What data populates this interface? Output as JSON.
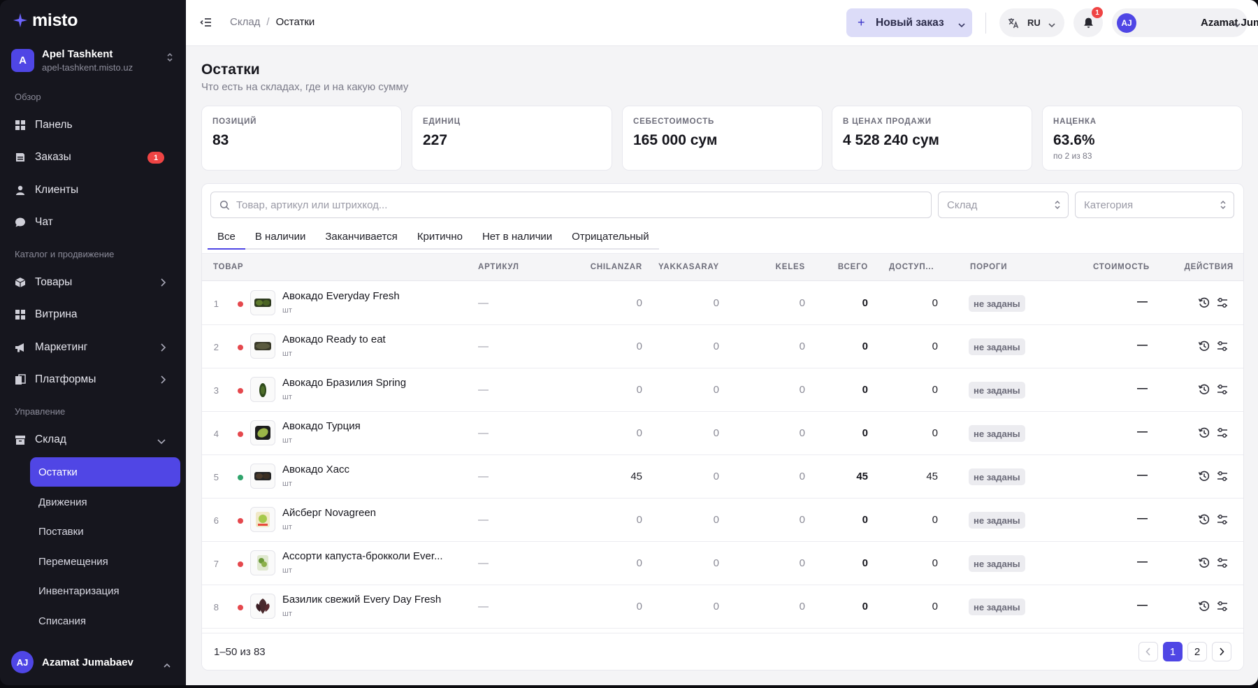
{
  "app": {
    "logo_text": "misto",
    "org_initial": "A",
    "org_name": "Apel Tashkent",
    "org_domain": "apel-tashkent.misto.uz"
  },
  "sidebar": {
    "sections": [
      "Обзор",
      "Каталог и продвижение",
      "Управление"
    ],
    "items": [
      {
        "label": "Панель",
        "icon": "dashboard-icon"
      },
      {
        "label": "Заказы",
        "icon": "orders-icon",
        "badge": "1"
      },
      {
        "label": "Клиенты",
        "icon": "users-icon"
      },
      {
        "label": "Чат",
        "icon": "chat-icon"
      },
      {
        "label": "Товары",
        "icon": "box-icon"
      },
      {
        "label": "Витрина",
        "icon": "storefront-icon"
      },
      {
        "label": "Маркетинг",
        "icon": "megaphone-icon"
      },
      {
        "label": "Платформы",
        "icon": "platforms-icon"
      },
      {
        "label": "Склад",
        "icon": "warehouse-icon"
      }
    ],
    "warehouse_sub": [
      "Остатки",
      "Движения",
      "Поставки",
      "Перемещения",
      "Инвентаризация",
      "Списания"
    ],
    "active_sub": "Остатки",
    "user_initials": "AJ",
    "user_name": "Azamat Jumabaev"
  },
  "topbar": {
    "breadcrumb_parent": "Склад",
    "breadcrumb_sep": "/",
    "breadcrumb_current": "Остатки",
    "new_order_label": "Новый заказ",
    "lang": "RU",
    "notifications": "1",
    "user_initials": "AJ",
    "user_name": "Azamat Jumabaev"
  },
  "page": {
    "title": "Остатки",
    "subtitle": "Что есть на складах, где и на какую сумму"
  },
  "stats": [
    {
      "label": "ПОЗИЦИЙ",
      "value": "83",
      "note": ""
    },
    {
      "label": "ЕДИНИЦ",
      "value": "227",
      "note": ""
    },
    {
      "label": "СЕБЕСТОИМОСТЬ",
      "value": "165 000 сум",
      "note": ""
    },
    {
      "label": "В ЦЕНАХ ПРОДАЖИ",
      "value": "4 528 240 сум",
      "note": ""
    },
    {
      "label": "НАЦЕНКА",
      "value": "63.6%",
      "note": "по 2 из 83"
    }
  ],
  "filters": {
    "search_placeholder": "Товар, артикул или штрихкод...",
    "warehouse_placeholder": "Склад",
    "category_placeholder": "Категория"
  },
  "tabs": [
    "Все",
    "В наличии",
    "Заканчивается",
    "Критично",
    "Нет в наличии",
    "Отрицательный"
  ],
  "active_tab": "Все",
  "table": {
    "headers": {
      "product": "ТОВАР",
      "sku": "АРТИКУЛ",
      "chilanzar": "CHILANZAR",
      "yakkasaray": "YAKKASARAY",
      "keles": "KELES",
      "total": "ВСЕГО",
      "available": "ДОСТУП...",
      "thresholds": "ПОРОГИ",
      "cost": "СТОИМОСТЬ",
      "actions": "ДЕЙСТВИЯ"
    },
    "rows": [
      {
        "n": "1",
        "status": "red",
        "name": "Авокадо Everyday Fresh",
        "unit": "шт",
        "sku": "—",
        "chilanzar": "0",
        "yakkasaray": "0",
        "keles": "0",
        "total": "0",
        "available": "0",
        "threshold": "не заданы",
        "cost": "—",
        "thumb": "avocado-pack"
      },
      {
        "n": "2",
        "status": "red",
        "name": "Авокадо Ready to eat",
        "unit": "шт",
        "sku": "—",
        "chilanzar": "0",
        "yakkasaray": "0",
        "keles": "0",
        "total": "0",
        "available": "0",
        "threshold": "не заданы",
        "cost": "—",
        "thumb": "avocado-dark"
      },
      {
        "n": "3",
        "status": "red",
        "name": "Авокадо Бразилия Spring",
        "unit": "шт",
        "sku": "—",
        "chilanzar": "0",
        "yakkasaray": "0",
        "keles": "0",
        "total": "0",
        "available": "0",
        "threshold": "не заданы",
        "cost": "—",
        "thumb": "avocado-single"
      },
      {
        "n": "4",
        "status": "red",
        "name": "Авокадо Турция",
        "unit": "шт",
        "sku": "—",
        "chilanzar": "0",
        "yakkasaray": "0",
        "keles": "0",
        "total": "0",
        "available": "0",
        "threshold": "не заданы",
        "cost": "—",
        "thumb": "avocado-green"
      },
      {
        "n": "5",
        "status": "green",
        "name": "Авокадо Хасс",
        "unit": "шт",
        "sku": "—",
        "chilanzar": "45",
        "yakkasaray": "0",
        "keles": "0",
        "total": "45",
        "available": "45",
        "threshold": "не заданы",
        "cost": "—",
        "thumb": "avocado-hass"
      },
      {
        "n": "6",
        "status": "red",
        "name": "Айсберг Novagreen",
        "unit": "шт",
        "sku": "—",
        "chilanzar": "0",
        "yakkasaray": "0",
        "keles": "0",
        "total": "0",
        "available": "0",
        "threshold": "не заданы",
        "cost": "—",
        "thumb": "lettuce-pack"
      },
      {
        "n": "7",
        "status": "red",
        "name": "Ассорти капуста-брокколи Ever...",
        "unit": "шт",
        "sku": "—",
        "chilanzar": "0",
        "yakkasaray": "0",
        "keles": "0",
        "total": "0",
        "available": "0",
        "threshold": "не заданы",
        "cost": "—",
        "thumb": "broccoli-pack"
      },
      {
        "n": "8",
        "status": "red",
        "name": "Базилик свежий Every Day Fresh",
        "unit": "шт",
        "sku": "—",
        "chilanzar": "0",
        "yakkasaray": "0",
        "keles": "0",
        "total": "0",
        "available": "0",
        "threshold": "не заданы",
        "cost": "—",
        "thumb": "basil"
      }
    ]
  },
  "pagination": {
    "range": "1–50 из 83",
    "pages": [
      "1",
      "2"
    ],
    "current": "1"
  },
  "colors": {
    "accent": "#4f46e5",
    "sidebar_bg": "#16161e",
    "status_red": "#e5484d",
    "status_green": "#30a46c"
  }
}
